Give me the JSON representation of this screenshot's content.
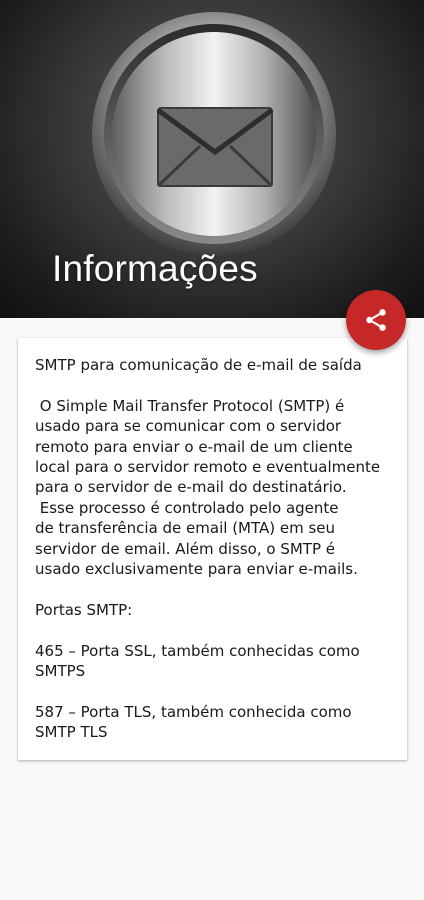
{
  "header": {
    "title": "Informações"
  },
  "share_button": {
    "icon": "share-icon",
    "color": "#c62828"
  },
  "content": {
    "heading": "SMTP para comunicação de e-mail de saída",
    "paragraph_lines": [
      " O Simple Mail Transfer Protocol (SMTP) é",
      "usado para se comunicar com o servidor",
      "remoto para enviar o e-mail de um cliente",
      "local para o servidor remoto e eventualmente",
      "para o servidor de e-mail do destinatário.",
      " Esse processo é controlado pelo agente",
      "de transferência de email (MTA) em seu",
      "servidor de email. Além disso, o SMTP é",
      "usado exclusivamente para enviar e-mails."
    ],
    "ports_heading": "Portas SMTP:",
    "port_465_lines": [
      "465 – Porta SSL, também conhecidas como",
      "SMTPS"
    ],
    "port_587_lines": [
      "587 – Porta TLS, também conhecida como",
      "SMTP TLS"
    ]
  }
}
